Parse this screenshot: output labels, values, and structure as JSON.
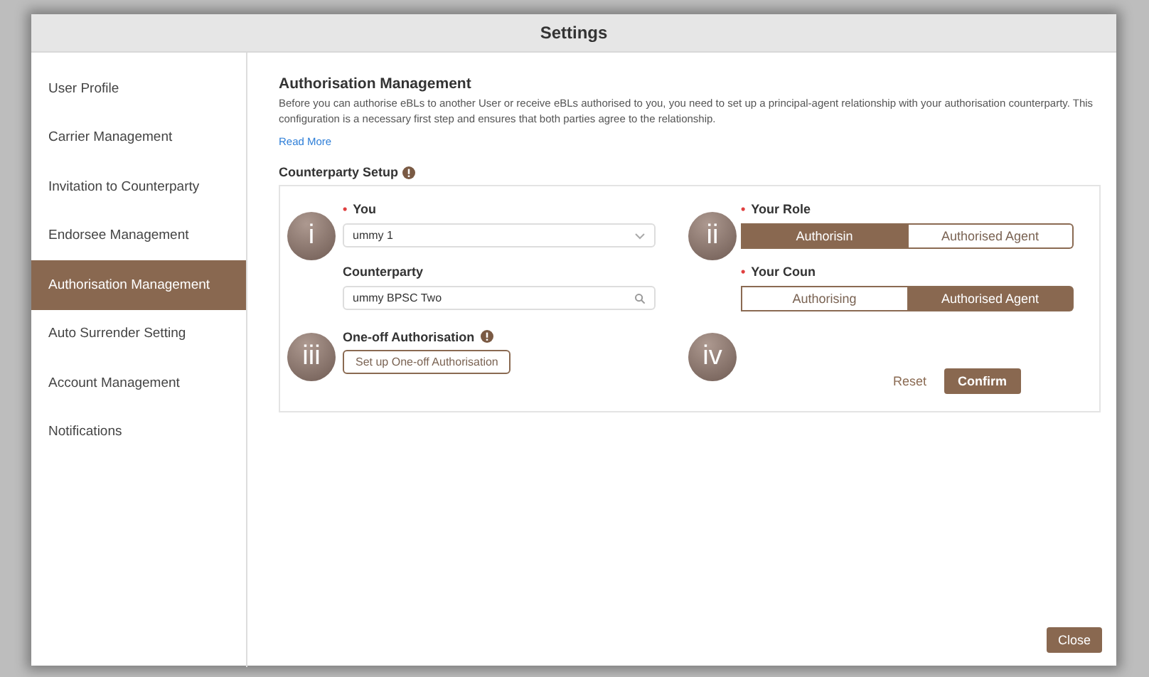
{
  "window": {
    "title": "Settings"
  },
  "sidebar": {
    "items": [
      {
        "label": "User Profile",
        "selected": false
      },
      {
        "label": "Carrier Management",
        "selected": false
      },
      {
        "label": "Invitation to Counterparty",
        "selected": false
      },
      {
        "label": "Endorsee Management",
        "selected": false
      },
      {
        "label": "Authorisation Management",
        "selected": true
      },
      {
        "label": "Auto Surrender Setting",
        "selected": false
      },
      {
        "label": "Account Management",
        "selected": false
      },
      {
        "label": "Notifications",
        "selected": false
      }
    ]
  },
  "main": {
    "heading": "Authorisation Management",
    "description": "Before you can authorise eBLs to another User or receive eBLs authorised to you, you need to set up a principal-agent relationship with your authorisation counterparty. This configuration is a necessary first step and ensures that both parties agree to the relationship.",
    "read_more": "Read More",
    "section_title": "Counterparty Setup",
    "you": {
      "label": "You",
      "required_mark": "•",
      "value": "ummy 1"
    },
    "counterparty": {
      "label": "Counterparty",
      "value": "ummy BPSC Two"
    },
    "your_role": {
      "label": "Your Role",
      "required_mark": "•",
      "options": [
        {
          "label": "Authorisin",
          "selected": true
        },
        {
          "label": "Authorised Agent",
          "selected": false
        }
      ]
    },
    "your_counterparty_role": {
      "label": "Your Coun",
      "required_mark": "•",
      "options": [
        {
          "label": "Authorising",
          "selected": false
        },
        {
          "label": "Authorised Agent",
          "selected": true
        }
      ]
    },
    "one_off": {
      "title": "One-off Authorisation",
      "button": "Set up One-off Authorisation"
    },
    "reset": "Reset",
    "confirm": "Confirm"
  },
  "close": "Close",
  "callouts": [
    {
      "label": "i"
    },
    {
      "label": "ii"
    },
    {
      "label": "iii"
    },
    {
      "label": "iv"
    }
  ]
}
